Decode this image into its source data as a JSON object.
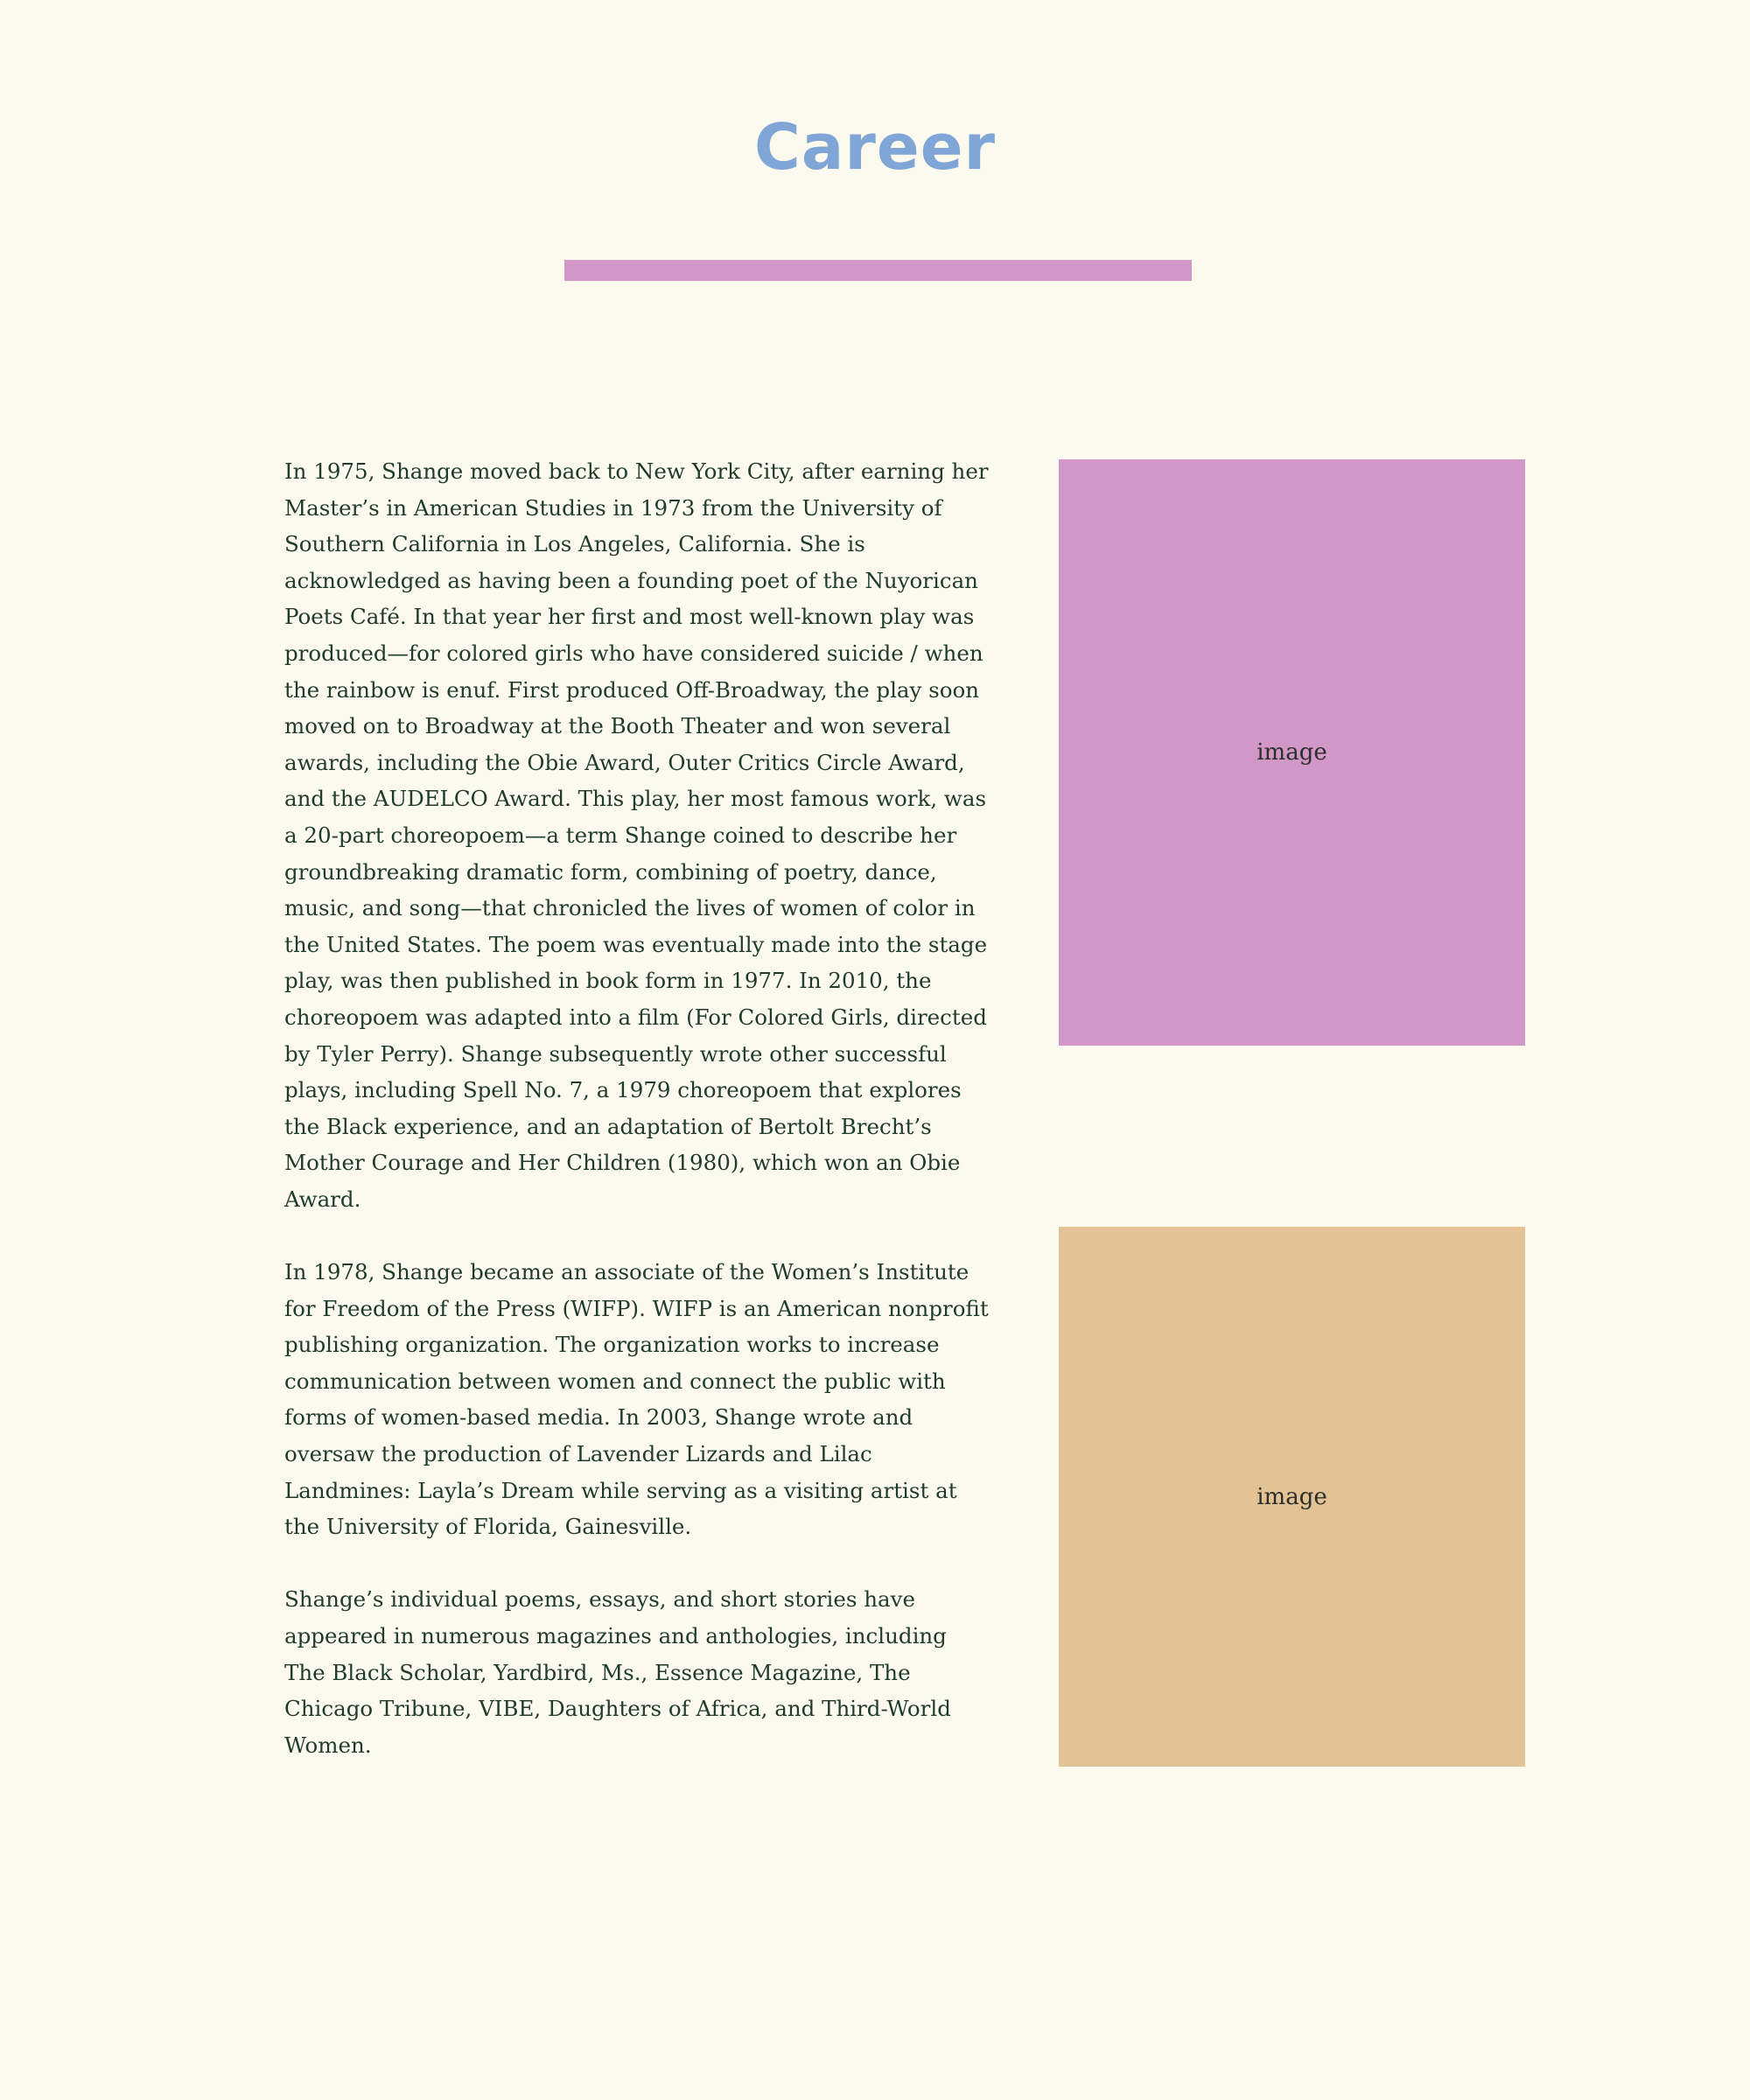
{
  "page": {
    "title": "Career",
    "colors": {
      "background": "#fcf9ee",
      "title": "#7fa6d6",
      "rule": "#d297c6",
      "text": "#1f3b2a",
      "image1": "#d197c6",
      "image2": "#e3c396"
    }
  },
  "paragraphs": [
    "In 1975, Shange moved back to New York City, after earning her Master’s in American Studies in 1973 from the University of Southern California in Los Angeles, California. She is acknowledged as having been a founding poet of the Nuyorican Poets Café. In that year her first and most well-known play was produced—for colored girls who have considered suicide / when the rainbow is enuf. First produced Off-Broadway, the play soon moved on to Broadway at the Booth Theater and won several awards, including the Obie Award, Outer Critics Circle Award, and the AUDELCO Award. This play, her most famous work, was a 20-part choreopoem—a term Shange coined to describe her groundbreaking dramatic form, combining of poetry, dance, music, and song—that chronicled the lives of women of color in the United States. The poem was eventually made into the stage play, was then published in book form in 1977. In 2010, the choreopoem was adapted into a film (For Colored Girls, directed by Tyler Perry). Shange subsequently wrote other successful plays, including Spell No. 7, a 1979 choreopoem that explores the Black experience, and an adaptation of Bertolt Brecht’s Mother Courage and Her Children (1980), which won an Obie Award.",
    "In 1978, Shange became an associate of the Women’s Institute for Freedom of the Press (WIFP). WIFP is an American nonprofit publishing organization. The organization works to increase communication between women and connect the public with forms of women-based media. In 2003, Shange wrote and oversaw the production of Lavender Lizards and Lilac Landmines: Layla’s Dream while serving as a visiting artist at the University of Florida, Gainesville.",
    "Shange’s individual poems, essays, and short stories have appeared in numerous magazines and anthologies, including The Black Scholar, Yardbird, Ms., Essence Magazine, The Chicago Tribune, VIBE, Daughters of Africa, and Third-World Women."
  ],
  "images": [
    {
      "label": "image"
    },
    {
      "label": "image"
    }
  ]
}
